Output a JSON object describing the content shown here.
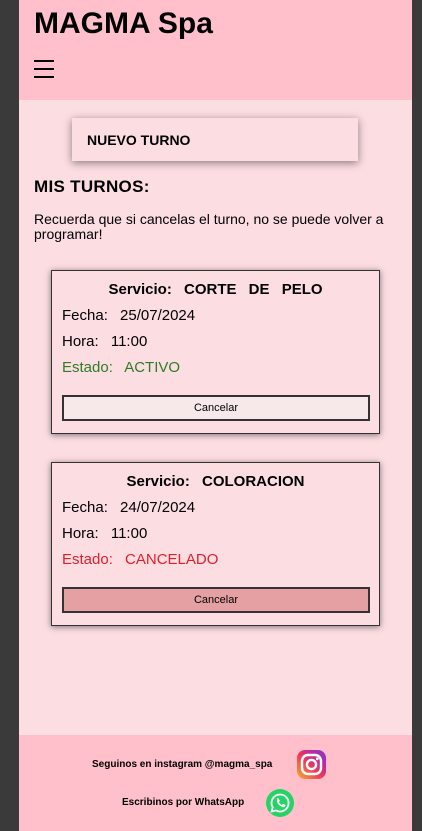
{
  "header": {
    "brand": "MAGMA Spa",
    "menu_icon": "hamburger-icon"
  },
  "main": {
    "new_appointment_label": "NUEVO TURNO",
    "section_title": "MIS TURNOS:",
    "notice": "Recuerda que si cancelas el turno, no se puede volver a programar!"
  },
  "labels": {
    "service": "Servicio:",
    "date": "Fecha:",
    "time": "Hora:",
    "status": "Estado:",
    "cancel": "Cancelar"
  },
  "appointments": [
    {
      "service": "CORTE DE PELO",
      "date": "25/07/2024",
      "time": "11:00",
      "status": "ACTIVO",
      "status_color": "#2e7d22"
    },
    {
      "service": "COLORACION",
      "date": "24/07/2024",
      "time": "11:00",
      "status": "CANCELADO",
      "status_color": "#e0202c"
    }
  ],
  "footer": {
    "instagram_text": "Seguinos en instagram @magma_spa",
    "instagram_icon": "instagram-icon",
    "whatsapp_text": "Escribinos por WhatsApp",
    "whatsapp_icon": "whatsapp-icon"
  },
  "colors": {
    "header_bg": "#ffc0cb",
    "page_bg": "#fcdde2",
    "outer_bg": "#3a3a3a"
  }
}
